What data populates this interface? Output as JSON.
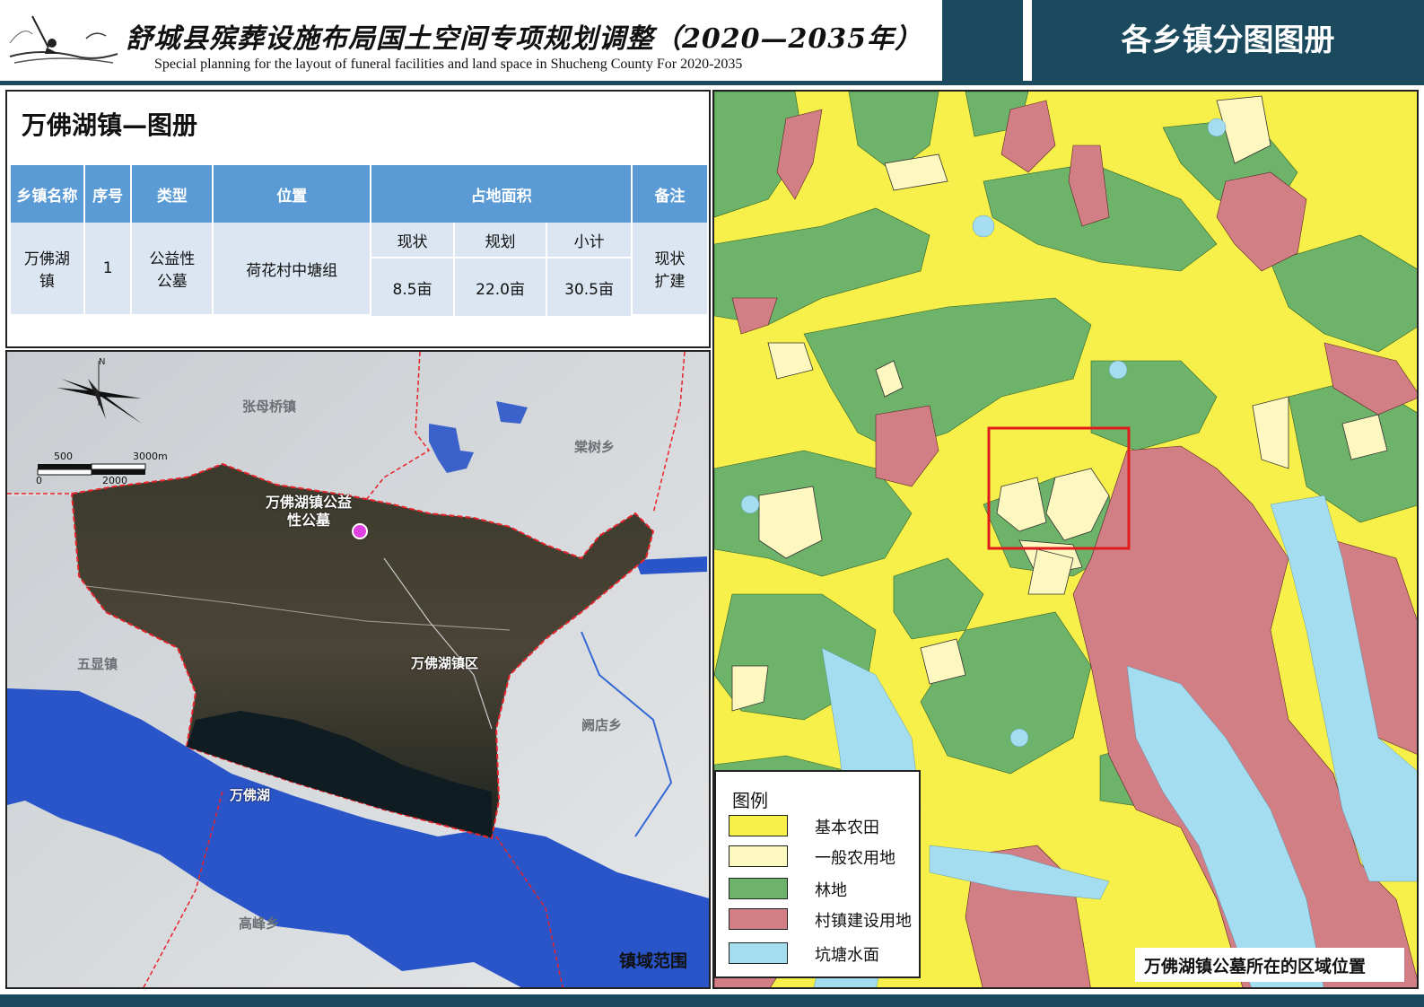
{
  "header": {
    "title_cn": "舒城县殡葬设施布局国土空间专项规划调整（2020—2035年）",
    "title_en": "Special planning for the layout of funeral facilities and land space in Shucheng County For 2020-2035",
    "section_title": "各乡镇分图图册"
  },
  "info": {
    "town_title": "万佛湖镇—图册",
    "columns": {
      "town": "乡镇名称",
      "seq": "序号",
      "type": "类型",
      "location": "位置",
      "area": "占地面积",
      "note": "备注",
      "current": "现状",
      "planned": "规划",
      "subtotal": "小计"
    },
    "row": {
      "town": "万佛湖镇",
      "seq": "1",
      "type": "公益性公墓",
      "location": "荷花村中塘组",
      "current": "8.5亩",
      "planned": "22.0亩",
      "subtotal": "30.5亩",
      "note": "现状扩建"
    }
  },
  "town_map": {
    "north": "N",
    "scale_500": "500",
    "scale_3000": "3000m",
    "scale_0": "0",
    "scale_2000": "2000",
    "cemetery_label": "万佛湖镇公益性公墓",
    "labels": {
      "zhangmuqiao": "张母桥镇",
      "tangshu": "棠树乡",
      "wuxian": "五显镇",
      "district": "万佛湖镇区",
      "queidian": "阙店乡",
      "lake": "万佛湖",
      "gaofeng": "高峰乡"
    },
    "scope_label": "镇域范围",
    "colors": {
      "boundary": "#e8242b",
      "water": "#2a55c9",
      "cemetery_point": "#e040e0"
    }
  },
  "land_map": {
    "legend_title": "图例",
    "legend": [
      {
        "label": "基本农田",
        "color": "#f7f04a"
      },
      {
        "label": "一般农用地",
        "color": "#fdf8bf"
      },
      {
        "label": "林地",
        "color": "#6db36a"
      },
      {
        "label": "村镇建设用地",
        "color": "#d17e84"
      },
      {
        "label": "坑塘水面",
        "color": "#a4dcf0"
      }
    ],
    "caption": "万佛湖镇公墓所在的区域位置",
    "highlight_color": "#e11b1b"
  }
}
